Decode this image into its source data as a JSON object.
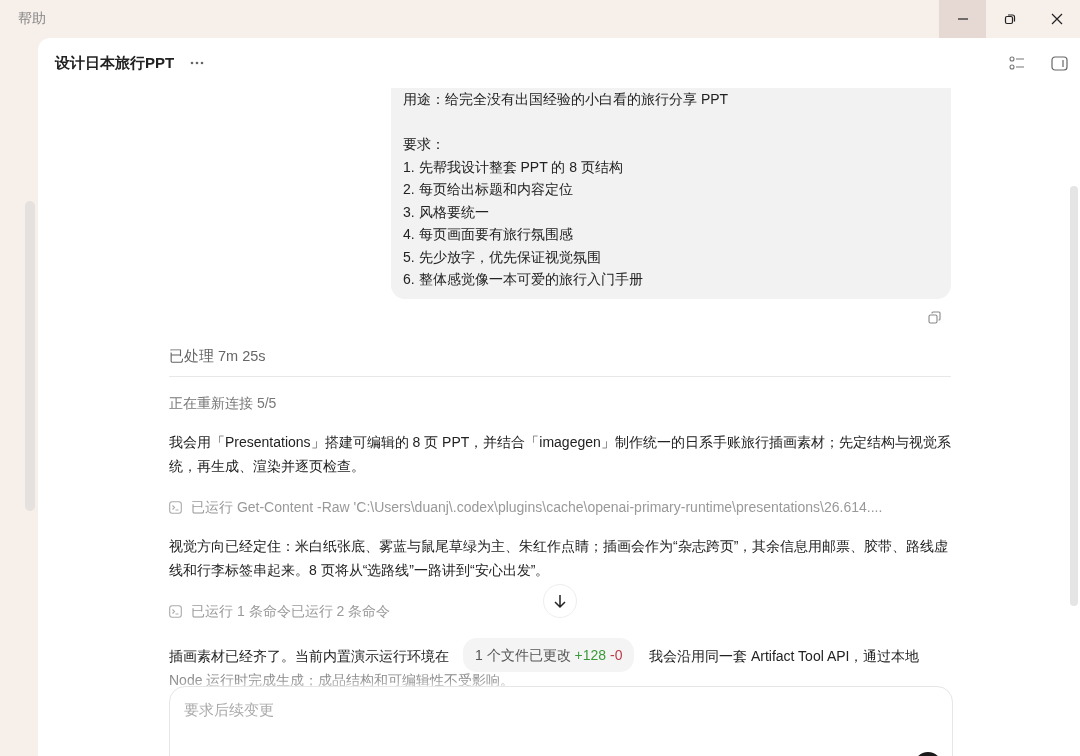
{
  "titlebar": {
    "menu": "帮助"
  },
  "header": {
    "title": "设计日本旅行PPT"
  },
  "user_message": {
    "blocks": [
      {
        "lines": [
          "用途：给完全没有出国经验的小白看的旅行分享 PPT"
        ]
      },
      {
        "lines": [
          "要求：",
          "1. 先帮我设计整套 PPT 的 8 页结构",
          "2. 每页给出标题和内容定位",
          "3. 风格要统一",
          "4. 每页画面要有旅行氛围感",
          "5. 先少放字，优先保证视觉氛围",
          "6. 整体感觉像一本可爱的旅行入门手册"
        ]
      }
    ]
  },
  "processed": "已处理 7m 25s",
  "reconnect": "正在重新连接 5/5",
  "items": [
    {
      "kind": "text",
      "text": "我会用「Presentations」搭建可编辑的 8 页 PPT，并结合「imagegen」制作统一的日系手账旅行插画素材；先定结构与视觉系统，再生成、渲染并逐页检查。"
    },
    {
      "kind": "command",
      "text": "已运行 Get-Content -Raw 'C:\\Users\\duanj\\.codex\\plugins\\cache\\openai-primary-runtime\\presentations\\26.614...."
    },
    {
      "kind": "text",
      "text": "视觉方向已经定住：米白纸张底、雾蓝与鼠尾草绿为主、朱红作点睛；插画会作为“杂志跨页”，其余信息用邮票、胶带、路线虚线和行李标签串起来。8 页将从“选路线”一路讲到“安心出发”。"
    },
    {
      "kind": "command",
      "text": "已运行 1 条命令已运行 2 条命令"
    },
    {
      "kind": "covered",
      "segments": [
        "插画素材已经齐了。当前内置演示运行环境在",
        "我会沿用同一套 Artifact Tool API，通过本地"
      ],
      "continuation": "Node 运行时完成生成；成品结构和可编辑性不受影响。"
    }
  ],
  "file_changes": {
    "label": "1 个文件已更改",
    "added": "+128",
    "removed": "-0"
  },
  "composer": {
    "placeholder": "要求后续变更"
  }
}
